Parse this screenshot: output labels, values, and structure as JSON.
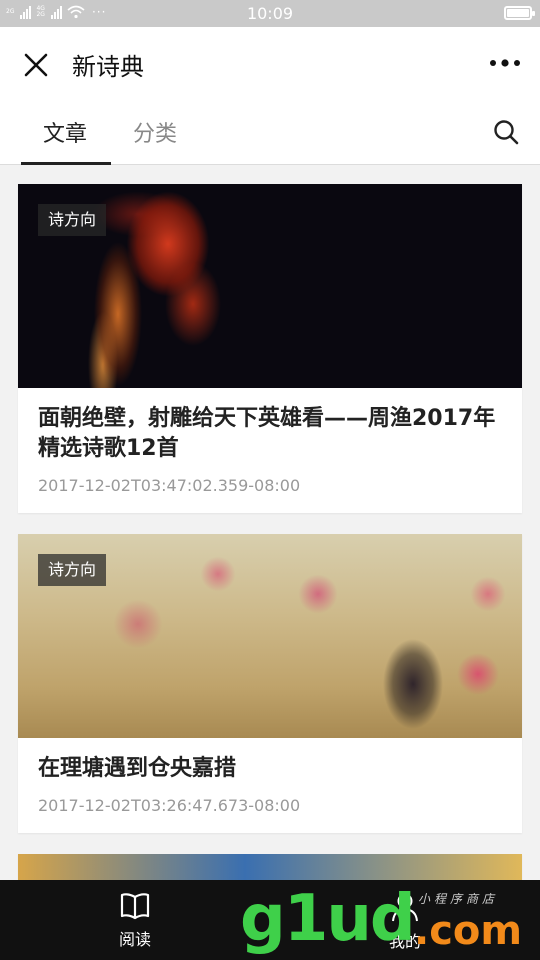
{
  "status_bar": {
    "time": "10:09",
    "network_labels": [
      "2G",
      "4G",
      "2G"
    ],
    "extra_dots": "···",
    "icons": [
      "signal-icon",
      "wifi-icon",
      "battery-icon"
    ]
  },
  "title_bar": {
    "title": "新诗典",
    "close_icon": "close-icon",
    "more_icon": "more-icon"
  },
  "tabs": [
    {
      "label": "文章",
      "active": true
    },
    {
      "label": "分类",
      "active": false
    }
  ],
  "search_icon": "search-icon",
  "articles": [
    {
      "badge": "诗方向",
      "title": "面朝绝壁，射雕给天下英雄看——周渔2017年精选诗歌12首",
      "time": "2017-12-02T03:47:02.359-08:00",
      "image": "red-smoke-on-black"
    },
    {
      "badge": "诗方向",
      "title": "在理塘遇到仓央嘉措",
      "time": "2017-12-02T03:26:47.673-08:00",
      "image": "plum-blossom-painting"
    },
    {
      "badge": "",
      "image": "partial-colorful-image"
    }
  ],
  "bottom_nav": [
    {
      "label": "阅读",
      "icon": "book-icon"
    },
    {
      "label": "我的",
      "icon": "user-icon"
    }
  ],
  "watermark": {
    "main": "g1ud",
    "suffix": ".com",
    "sub": "小程序商店"
  },
  "colors": {
    "status_bar": "#c9c9c9",
    "bottom_nav": "#111111",
    "watermark_green": "#3fd04a",
    "watermark_orange": "#f28a1a"
  }
}
